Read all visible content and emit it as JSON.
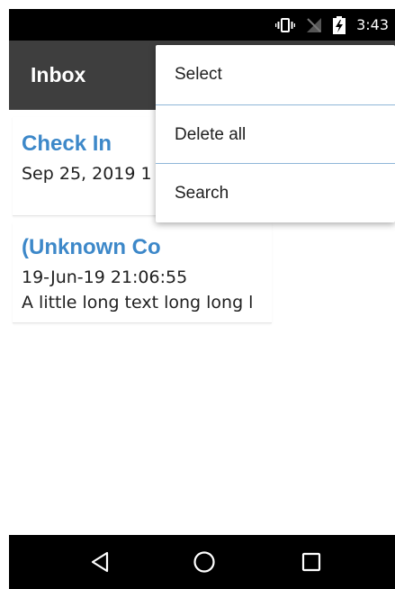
{
  "status_bar": {
    "time": "3:43",
    "icons": [
      "vibrate-icon",
      "no-sim-icon",
      "battery-charging-icon"
    ]
  },
  "app_bar": {
    "title": "Inbox"
  },
  "messages": [
    {
      "title": "Check In",
      "date": "Sep 25, 2019 1",
      "body": ""
    },
    {
      "title": "(Unknown Co",
      "date": "19-Jun-19 21:06:55",
      "body": "A little long text long long l"
    }
  ],
  "overflow_menu": {
    "items": [
      {
        "label": "Select"
      },
      {
        "label": "Delete all"
      },
      {
        "label": "Search"
      }
    ]
  },
  "nav_bar": {
    "icons": [
      "back-icon",
      "home-icon",
      "recents-icon"
    ]
  },
  "colors": {
    "app_bar": "#3e3e3e",
    "status_bar": "#000000",
    "title_text": "#3d88c9",
    "menu_divider": "#8fb6d8"
  }
}
